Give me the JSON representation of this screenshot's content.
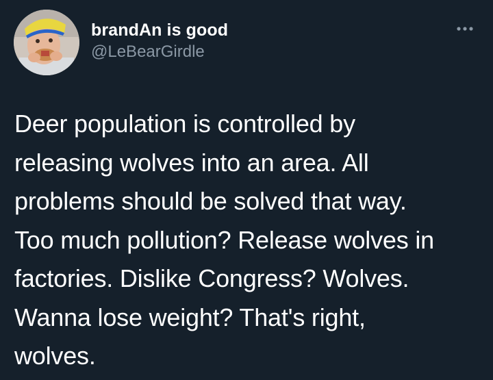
{
  "tweet": {
    "author": {
      "display_name": "brandAn is good",
      "handle": "@LeBearGirdle",
      "avatar_icon": "user-avatar-photo"
    },
    "more_icon": "more-dots-icon",
    "text_lines": [
      "Deer population is controlled by",
      "releasing wolves into an area. All",
      "problems should be solved that way.",
      "Too much pollution? Release wolves in",
      "factories. Dislike Congress? Wolves.",
      "Wanna lose weight? That's right,",
      "wolves."
    ]
  },
  "colors": {
    "background": "#15202b",
    "text_primary": "#ffffff",
    "text_secondary": "#8b98a5"
  }
}
